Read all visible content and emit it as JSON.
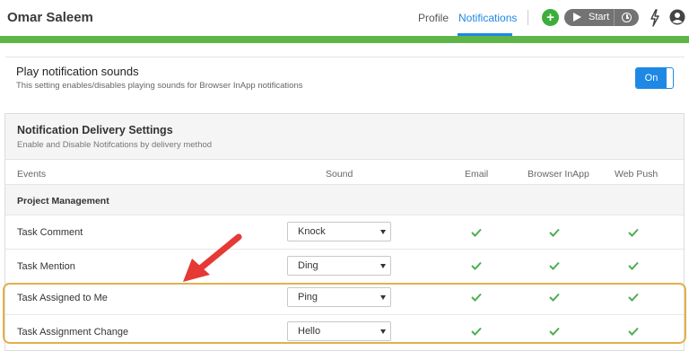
{
  "header": {
    "user_name": "Omar Saleem",
    "tabs": [
      {
        "label": "Profile",
        "active": false
      },
      {
        "label": "Notifications",
        "active": true
      }
    ],
    "start_label": "Start",
    "add_icon": "plus-icon",
    "colors": {
      "accent": "#1e88e5",
      "brand_bar": "#5fb648",
      "add": "#3cae3c"
    }
  },
  "sound_setting": {
    "title": "Play notification sounds",
    "description": "This setting enables/disables playing sounds for Browser InApp notifications",
    "toggle_label": "On"
  },
  "delivery": {
    "title": "Notification Delivery Settings",
    "subtitle": "Enable and Disable Notifcations by delivery method",
    "columns": {
      "events": "Events",
      "sound": "Sound",
      "email": "Email",
      "browser": "Browser InApp",
      "webpush": "Web Push"
    },
    "group": "Project Management",
    "rows": [
      {
        "event": "Task Comment",
        "sound": "Knock",
        "email": true,
        "browser": true,
        "webpush": true
      },
      {
        "event": "Task Mention",
        "sound": "Ding",
        "email": true,
        "browser": true,
        "webpush": true
      },
      {
        "event": "Task Assigned to Me",
        "sound": "Ping",
        "email": true,
        "browser": true,
        "webpush": true
      },
      {
        "event": "Task Assignment Change",
        "sound": "Hello",
        "email": true,
        "browser": true,
        "webpush": true
      }
    ],
    "check_color": "#4caf50",
    "highlight_color": "#e3b04a",
    "arrow_color": "#e53935"
  }
}
